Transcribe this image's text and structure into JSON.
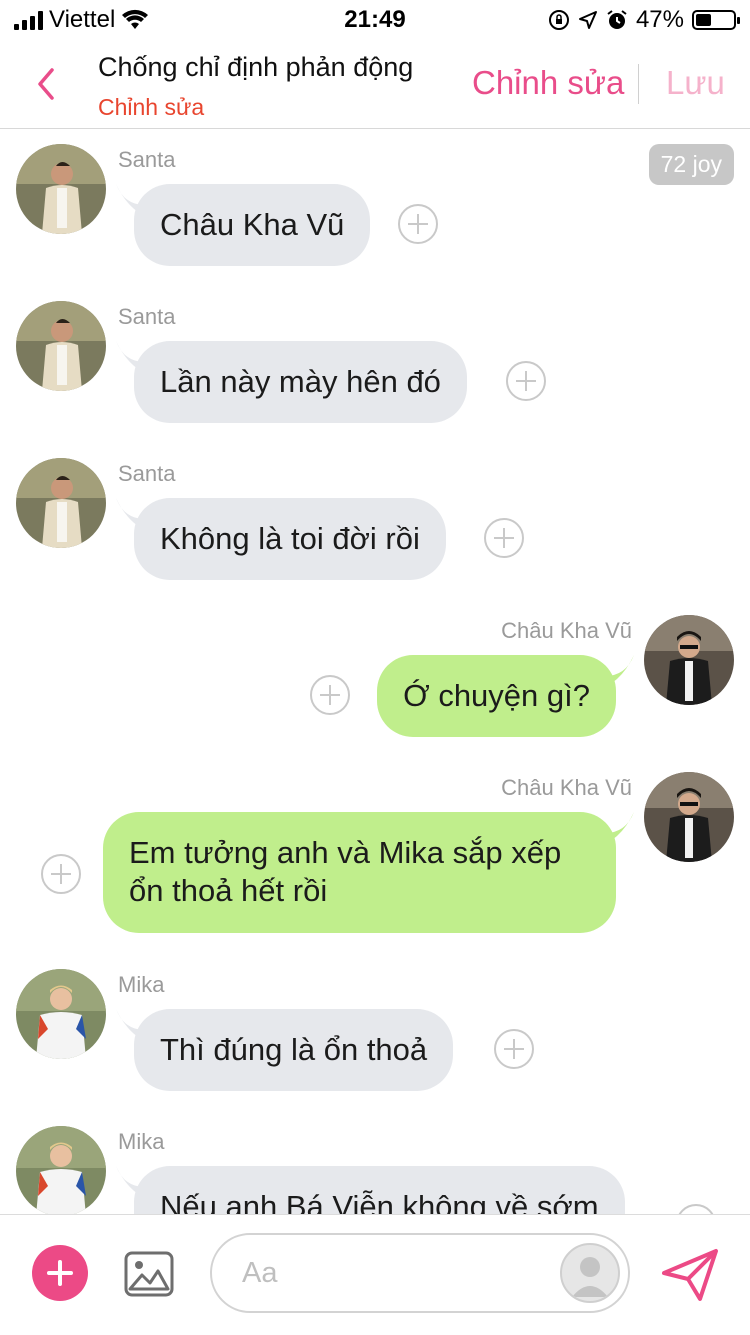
{
  "status_bar": {
    "carrier": "Viettel",
    "time": "21:49",
    "battery": "47%"
  },
  "header": {
    "title": "Chống chỉ định phản động",
    "subtitle": "Chỉnh sửa",
    "edit_label": "Chỉnh sửa",
    "save_label": "Lưu"
  },
  "badge": "72 joy",
  "messages": [
    {
      "sender": "Santa",
      "text": "Châu Kha Vũ",
      "side": "left"
    },
    {
      "sender": "Santa",
      "text": "Lần này mày hên đó",
      "side": "left"
    },
    {
      "sender": "Santa",
      "text": "Không là toi đời rồi",
      "side": "left"
    },
    {
      "sender": "Châu Kha Vũ",
      "text": "Ớ chuyện gì?",
      "side": "right"
    },
    {
      "sender": "Châu Kha Vũ",
      "text": "Em tưởng anh và Mika sắp xếp ổn thoả hết rồi",
      "side": "right"
    },
    {
      "sender": "Mika",
      "text": "Thì đúng là ổn thoả",
      "side": "left"
    },
    {
      "sender": "Mika",
      "text": "Nếu anh Bá Viễn không về sớm",
      "side": "left"
    }
  ],
  "composer": {
    "placeholder": "Aa"
  },
  "colors": {
    "accent": "#ec4a86",
    "right_bubble": "#c0ee8c",
    "left_bubble": "#e6e8ec",
    "subtitle": "#e8452e"
  }
}
